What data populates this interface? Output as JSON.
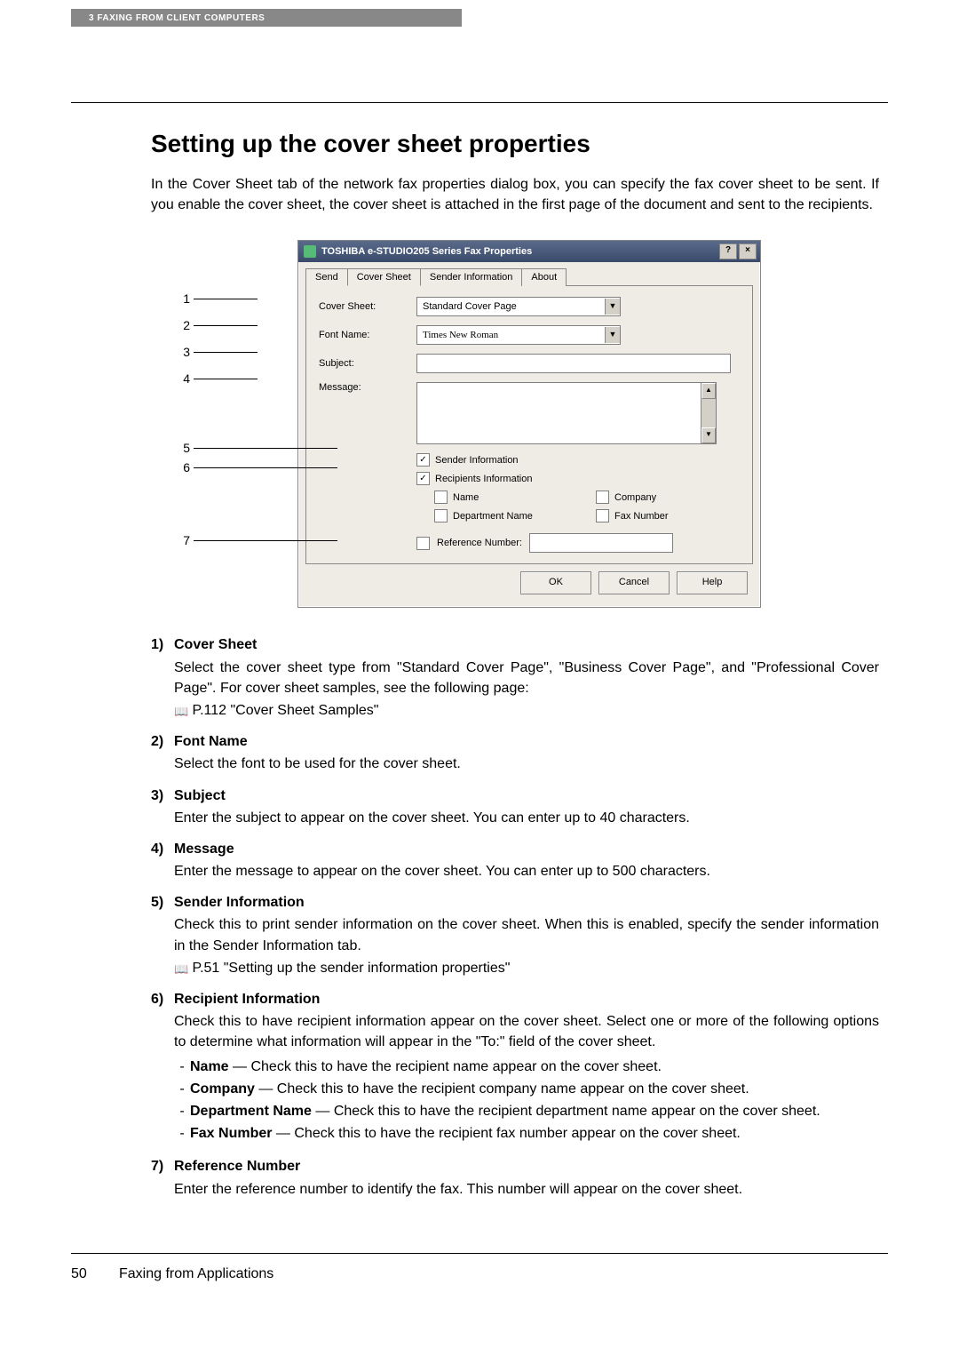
{
  "header": {
    "chapter_label": "3  FAXING FROM CLIENT COMPUTERS"
  },
  "title": "Setting up the cover sheet properties",
  "intro": "In the Cover Sheet tab of the network fax properties dialog box, you can specify the fax cover sheet to be sent. If you enable the cover sheet, the cover sheet is attached in the first page of the document and sent to the recipients.",
  "callouts": {
    "n1": "1",
    "n2": "2",
    "n3": "3",
    "n4": "4",
    "n5": "5",
    "n6": "6",
    "n7": "7"
  },
  "dialog": {
    "title": "TOSHIBA e-STUDIO205 Series Fax Properties",
    "help_btn": "?",
    "close_btn": "×",
    "tabs": {
      "send": "Send",
      "cover": "Cover Sheet",
      "sender": "Sender Information",
      "about": "About"
    },
    "labels": {
      "cover_sheet": "Cover Sheet:",
      "font_name": "Font Name:",
      "subject": "Subject:",
      "message": "Message:",
      "sender_info": "Sender Information",
      "recipients_info": "Recipients Information",
      "name": "Name",
      "company": "Company",
      "dept": "Department Name",
      "fax": "Fax Number",
      "ref_num": "Reference Number:"
    },
    "values": {
      "cover_sheet": "Standard Cover Page",
      "font_name": "Times New Roman",
      "sender_checked": "✓",
      "recipients_checked": "✓"
    },
    "buttons": {
      "ok": "OK",
      "cancel": "Cancel",
      "help": "Help"
    },
    "scroll": {
      "up": "▲",
      "down": "▼"
    },
    "dropdown_arrow": "▼"
  },
  "desc": {
    "d1": {
      "num": "1)",
      "title": "Cover Sheet",
      "text": "Select the cover sheet type from \"Standard Cover Page\", \"Business Cover Page\", and \"Professional Cover Page\". For cover sheet samples, see the following page:",
      "ref": "P.112 \"Cover Sheet Samples\""
    },
    "d2": {
      "num": "2)",
      "title": "Font Name",
      "text": "Select the font to be used for the cover sheet."
    },
    "d3": {
      "num": "3)",
      "title": "Subject",
      "text": "Enter the subject to appear on the cover sheet. You can enter up to 40 characters."
    },
    "d4": {
      "num": "4)",
      "title": "Message",
      "text": "Enter the message to appear on the cover sheet. You can enter up to 500 characters."
    },
    "d5": {
      "num": "5)",
      "title": "Sender Information",
      "text": "Check this to print sender information on the cover sheet. When this is enabled, specify the sender information in the Sender Information tab.",
      "ref": "P.51 \"Setting up the sender information properties\""
    },
    "d6": {
      "num": "6)",
      "title": "Recipient Information",
      "text": "Check this to have recipient information appear on the cover sheet. Select one or more of the following options to determine what information will appear in the \"To:\" field of the cover sheet.",
      "sub": {
        "name_t": "Name",
        "name_d": " — Check this to have the recipient name appear on the cover sheet.",
        "comp_t": "Company",
        "comp_d": " — Check this to have the recipient company name appear on the cover sheet.",
        "dept_t": "Department Name",
        "dept_d": " — Check this to have the recipient department name appear on the cover sheet.",
        "fax_t": "Fax Number",
        "fax_d": " — Check this to have the recipient fax number appear on the cover sheet."
      }
    },
    "d7": {
      "num": "7)",
      "title": "Reference Number",
      "text": "Enter the reference number to identify the fax. This number will appear on the cover sheet."
    }
  },
  "footer": {
    "page": "50",
    "section": "Faxing from Applications"
  },
  "icons": {
    "book": "📖"
  }
}
